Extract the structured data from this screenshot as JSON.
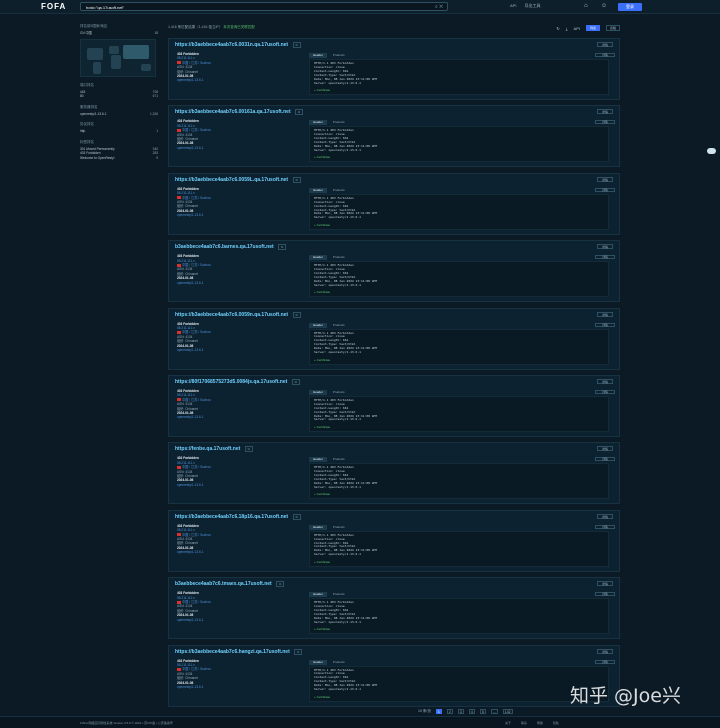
{
  "header": {
    "logo": "FOFA",
    "query": "host=\"qa.17usoft.net\"",
    "nav": [
      "API",
      "导出工具",
      "登录"
    ],
    "login_label": "登录"
  },
  "sidebar": {
    "blocks": [
      {
        "title": "排名前5国家/地区",
        "rows": [
          [
            "CN 中国",
            "18"
          ]
        ]
      },
      {
        "title": "端口排名",
        "rows": [
          [
            "443",
            "708"
          ],
          [
            "80",
            "671"
          ]
        ]
      },
      {
        "title": "服务器排名",
        "rows": [
          [
            "openresty/1.13.6.1",
            "1,326"
          ]
        ]
      },
      {
        "title": "协议排名",
        "rows": [
          [
            "http",
            "1"
          ]
        ]
      },
      {
        "title": "标签排名",
        "rows": [
          [
            "301 Moved Permanently",
            "340"
          ],
          [
            "403 Forbidden",
            "283"
          ],
          [
            "Welcome to OpenResty!",
            "9"
          ]
        ]
      }
    ]
  },
  "toolbar": {
    "summary": "1,416 条匹配结果（1,416 独立IP）",
    "hint": "本次查询已关联匹配",
    "views": [
      "列表",
      "表格"
    ]
  },
  "cards": [
    {
      "host": "https://b3aebbece4aab7c6.0031n.qa.17usoft.net",
      "ip": "58.211.111.x",
      "date": "2024-01-08",
      "server": "openresty/1.13.6.1"
    },
    {
      "host": "https://b3aebbece4aab7c6.00161a.qa.17usoft.net",
      "ip": "58.211.111.x",
      "date": "2024-01-08",
      "server": "openresty/1.13.6.1"
    },
    {
      "host": "https://b3aebbece4aab7c6.0059L.qa.17usoft.net",
      "ip": "58.211.111.x",
      "date": "2024-01-08",
      "server": "openresty/1.13.6.1"
    },
    {
      "host": "b3aebbece4aab7c6.barnes.qa.17usoft.net",
      "ip": "58.211.111.x",
      "date": "2024-01-08",
      "server": "openresty/1.13.6.1"
    },
    {
      "host": "https://b3aebbece4aab7c6.0059n.qa.17usoft.net",
      "ip": "58.211.111.x",
      "date": "2024-01-08",
      "server": "openresty/1.13.6.1"
    },
    {
      "host": "https://80f17068575273d5.0084js.qa.17usoft.net",
      "ip": "58.211.111.x",
      "date": "2024-01-08",
      "server": "openresty/1.13.6.1"
    },
    {
      "host": "https://fenbe.qa.17usoft.net",
      "ip": "58.211.111.x",
      "date": "2024-01-08",
      "server": "openresty/1.13.6.1"
    },
    {
      "host": "https://b3aebbece4aab7c6.18p16.qa.17usoft.net",
      "ip": "58.211.111.x",
      "date": "2024-01-08",
      "server": "openresty/1.13.6.1"
    },
    {
      "host": "b3aebbece4aab7c6.tmaex.qa.17usoft.net",
      "ip": "58.211.111.x",
      "date": "2024-01-08",
      "server": "openresty/1.13.6.1"
    },
    {
      "host": "https://b3aebbece4aab7c6.hangzi.qa.17usoft.net",
      "ip": "58.211.111.x",
      "date": "2024-01-08",
      "server": "openresty/1.13.6.1"
    }
  ],
  "card_common": {
    "title": "403 Forbidden",
    "location": "中国 / 江苏 / Suzhou",
    "asn": "ASN: 4134",
    "org": "组织: Chinanet",
    "tabs": [
      "Header",
      "Products"
    ],
    "banner": "HTTP/1.1 403 Forbidden\nConnection: close\nContent-Length: 661\nContent-Type: text/html\nDate: Mon, 08 Jan 2024 13:11:08 GMT\nServer: openresty/1.13.6.1",
    "cert": "Certificate",
    "btn": "详情"
  },
  "pagination": {
    "per_page": "10 条/页",
    "pages": [
      "1",
      "2",
      "3",
      "4",
      "5",
      "...",
      "142"
    ],
    "current": "1"
  },
  "footer": {
    "left": "FOFA 网络空间测绘系统  Version 4.5.0  © 2024  ▪  京ICP备  ▪  公安备案号",
    "links": [
      "关于",
      "联系",
      "帮助",
      "隐私"
    ]
  },
  "watermark": "知乎 @Joe兴"
}
